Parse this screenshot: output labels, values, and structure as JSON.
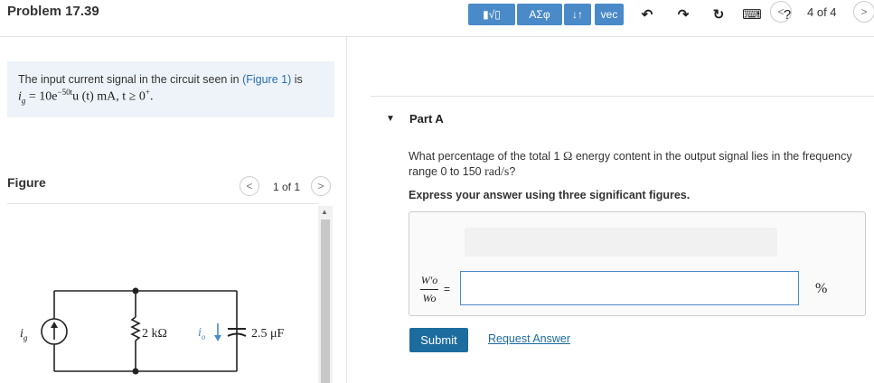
{
  "header": {
    "title": "Problem 17.39",
    "prev_glyph": "<",
    "next_glyph": ">",
    "page_counter": "4 of 4"
  },
  "problem": {
    "text_before": "The input current signal in the circuit seen in",
    "link": "(Figure 1)",
    "text_after": "is",
    "expression": {
      "lhs": "i",
      "lhs_sub": "g",
      "eq": " = 10e",
      "exponent": "−50t",
      "rest": "u (t)  mA,  t ≥ 0",
      "rest_sup": "+",
      "end": "."
    }
  },
  "figure": {
    "label": "Figure",
    "counter": "1 of 1",
    "circuit": {
      "source_label": "i",
      "source_sub": "g",
      "resistor_label": "2 kΩ",
      "current_label": "i",
      "current_sub": "o",
      "capacitor_label": "2.5 μF"
    }
  },
  "part": {
    "label": "Part A",
    "question_1": "What percentage of the total 1",
    "question_omega": "Ω",
    "question_2": "energy content in the output signal lies in the frequency",
    "question_3": "range 0 to 150",
    "question_units": "rad/s",
    "question_4": "?",
    "instruction": "Express your answer using three significant figures."
  },
  "toolbar": {
    "templates_label": "▮√▯",
    "greek_label": "ΑΣφ",
    "arrows_label": "↓↑",
    "vec_label": "vec",
    "undo_glyph": "↶",
    "redo_glyph": "↷",
    "reset_glyph": "↻",
    "keyboard_glyph": "⌨",
    "help_glyph": "?"
  },
  "answer": {
    "frac_num": "W′o",
    "frac_den": "Wo",
    "equals": "=",
    "value": "",
    "unit": "%"
  },
  "actions": {
    "submit_label": "Submit",
    "request_label": "Request Answer"
  },
  "colors": {
    "accent": "#4a8ac8",
    "submit": "#1c6c9f",
    "problem_bg": "#edf3f8"
  }
}
